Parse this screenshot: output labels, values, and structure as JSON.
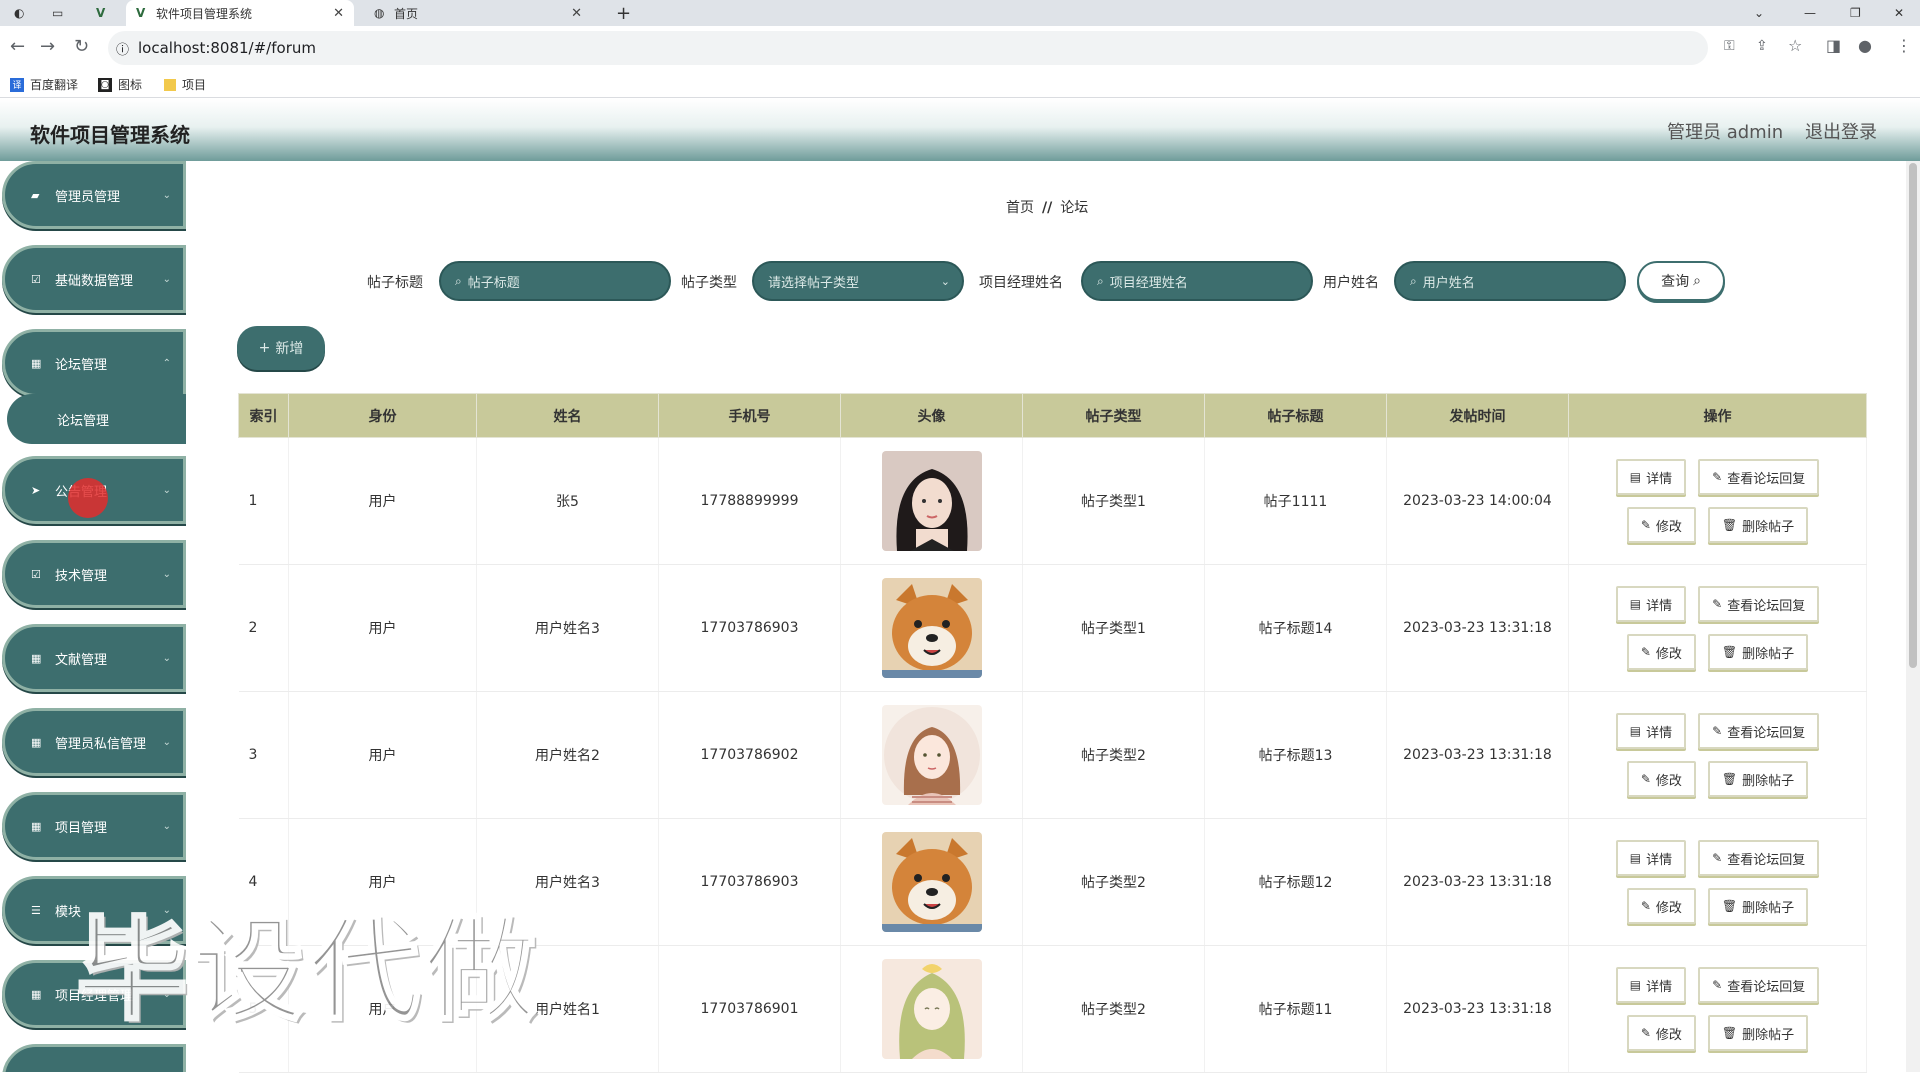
{
  "browser": {
    "tabs": [
      {
        "title": "软件项目管理系统",
        "active": true
      },
      {
        "title": "首页",
        "active": false
      }
    ],
    "url": "localhost:8081/#/forum",
    "bookmarks": [
      "百度翻译",
      "图标",
      "项目"
    ]
  },
  "header": {
    "title": "软件项目管理系统",
    "user_label": "管理员 admin",
    "logout_label": "退出登录"
  },
  "sidebar": {
    "items": [
      {
        "label": "管理员管理",
        "icon": "briefcase-icon"
      },
      {
        "label": "基础数据管理",
        "icon": "checkbox-icon"
      },
      {
        "label": "论坛管理",
        "icon": "grid-icon"
      },
      {
        "label": "公告管理",
        "icon": "send-icon"
      },
      {
        "label": "技术管理",
        "icon": "checkbox-icon"
      },
      {
        "label": "文献管理",
        "icon": "grid-icon"
      },
      {
        "label": "管理员私信管理",
        "icon": "grid-icon"
      },
      {
        "label": "项目管理",
        "icon": "grid-icon"
      },
      {
        "label": "模块",
        "icon": "list-icon"
      },
      {
        "label": "项目经理管理",
        "icon": "grid-icon"
      }
    ],
    "sub_item": "论坛管理"
  },
  "breadcrumb": {
    "home": "首页",
    "sep": "//",
    "current": "论坛"
  },
  "search": {
    "title_label": "帖子标题",
    "title_placeholder": "帖子标题",
    "type_label": "帖子类型",
    "type_placeholder": "请选择帖子类型",
    "manager_label": "项目经理姓名",
    "manager_placeholder": "项目经理姓名",
    "user_label": "用户姓名",
    "user_placeholder": "用户姓名",
    "query_button": "查询"
  },
  "add_button": "新增",
  "table": {
    "headers": [
      "索引",
      "身份",
      "姓名",
      "手机号",
      "头像",
      "帖子类型",
      "帖子标题",
      "发帖时间",
      "操作"
    ],
    "rows": [
      {
        "index": "1",
        "identity": "用户",
        "name": "张5",
        "phone": "17788899999",
        "avatar": "girl-portrait",
        "type": "帖子类型1",
        "title": "帖子1111",
        "time": "2023-03-23 14:00:04"
      },
      {
        "index": "2",
        "identity": "用户",
        "name": "用户姓名3",
        "phone": "17703786903",
        "avatar": "shiba-dog",
        "type": "帖子类型1",
        "title": "帖子标题14",
        "time": "2023-03-23 13:31:18"
      },
      {
        "index": "3",
        "identity": "用户",
        "name": "用户姓名2",
        "phone": "17703786902",
        "avatar": "illustrated-girl",
        "type": "帖子类型2",
        "title": "帖子标题13",
        "time": "2023-03-23 13:31:18"
      },
      {
        "index": "4",
        "identity": "用户",
        "name": "用户姓名3",
        "phone": "17703786903",
        "avatar": "shiba-dog",
        "type": "帖子类型2",
        "title": "帖子标题12",
        "time": "2023-03-23 13:31:18"
      },
      {
        "index": "5",
        "identity": "用户",
        "name": "用户姓名1",
        "phone": "17703786901",
        "avatar": "anime-girl",
        "type": "帖子类型2",
        "title": "帖子标题11",
        "time": "2023-03-23 13:31:18"
      }
    ],
    "actions": {
      "detail": "详情",
      "view_replies": "查看论坛回复",
      "edit": "修改",
      "delete": "删除帖子"
    }
  },
  "watermark": "毕设代做",
  "colors": {
    "sidebar": "#3d6e6e",
    "table_header": "#c8c99a"
  }
}
